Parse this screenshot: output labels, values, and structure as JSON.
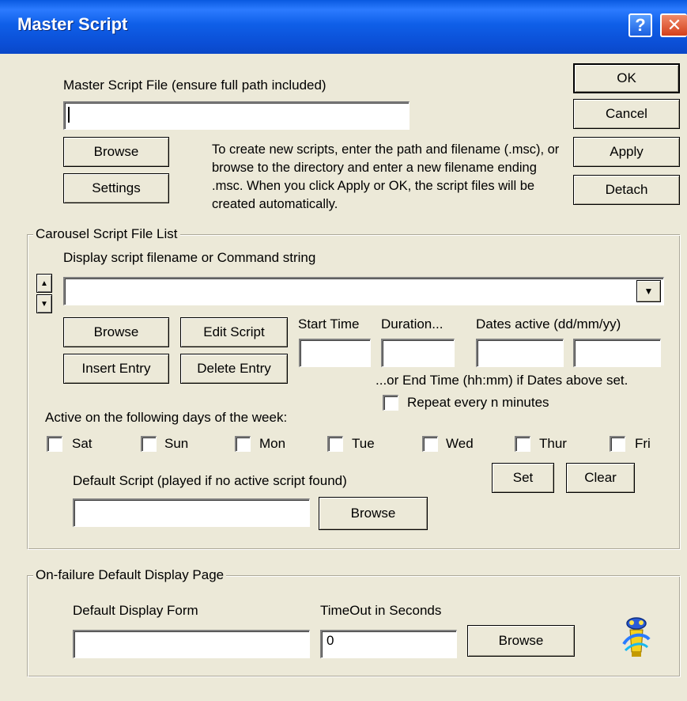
{
  "window": {
    "title": "Master Script",
    "help_glyph": "?",
    "close_glyph": "✕"
  },
  "master": {
    "file_label": "Master Script File (ensure full path included)",
    "file_value": "",
    "browse_label": "Browse",
    "settings_label": "Settings",
    "help_text": "To create new scripts, enter the path and filename (.msc), or browse to the directory and enter a new filename ending .msc. When you click Apply or OK, the script files will be created  automatically."
  },
  "actions": {
    "ok": "OK",
    "cancel": "Cancel",
    "apply": "Apply",
    "detach": "Detach"
  },
  "carousel": {
    "title": "Carousel Script File List",
    "display_label": "Display script filename or Command string",
    "display_value": "",
    "up_glyph": "▲",
    "down_glyph": "▼",
    "dropdown_glyph": "▼",
    "browse_label": "Browse",
    "edit_label": "Edit Script",
    "insert_label": "Insert Entry",
    "delete_label": "Delete Entry",
    "start_time_label": "Start Time",
    "duration_label": "Duration...",
    "dates_label": "Dates active (dd/mm/yy)",
    "start_time_value": "",
    "duration_value": "",
    "date_from_value": "",
    "date_to_value": "",
    "end_time_note": "...or End Time (hh:mm) if Dates above set.",
    "repeat_label": "Repeat every n minutes",
    "days_label": "Active on the following days of the week:",
    "days": [
      "Sat",
      "Sun",
      "Mon",
      "Tue",
      "Wed",
      "Thur",
      "Fri"
    ],
    "set_label": "Set",
    "clear_label": "Clear",
    "default_script_label": "Default Script (played if no active script found)",
    "default_script_value": "",
    "default_browse_label": "Browse"
  },
  "failure": {
    "title": "On-failure Default Display Page",
    "form_label": "Default Display Form",
    "form_value": "",
    "timeout_label": "TimeOut in Seconds",
    "timeout_value": "0",
    "browse_label": "Browse"
  }
}
